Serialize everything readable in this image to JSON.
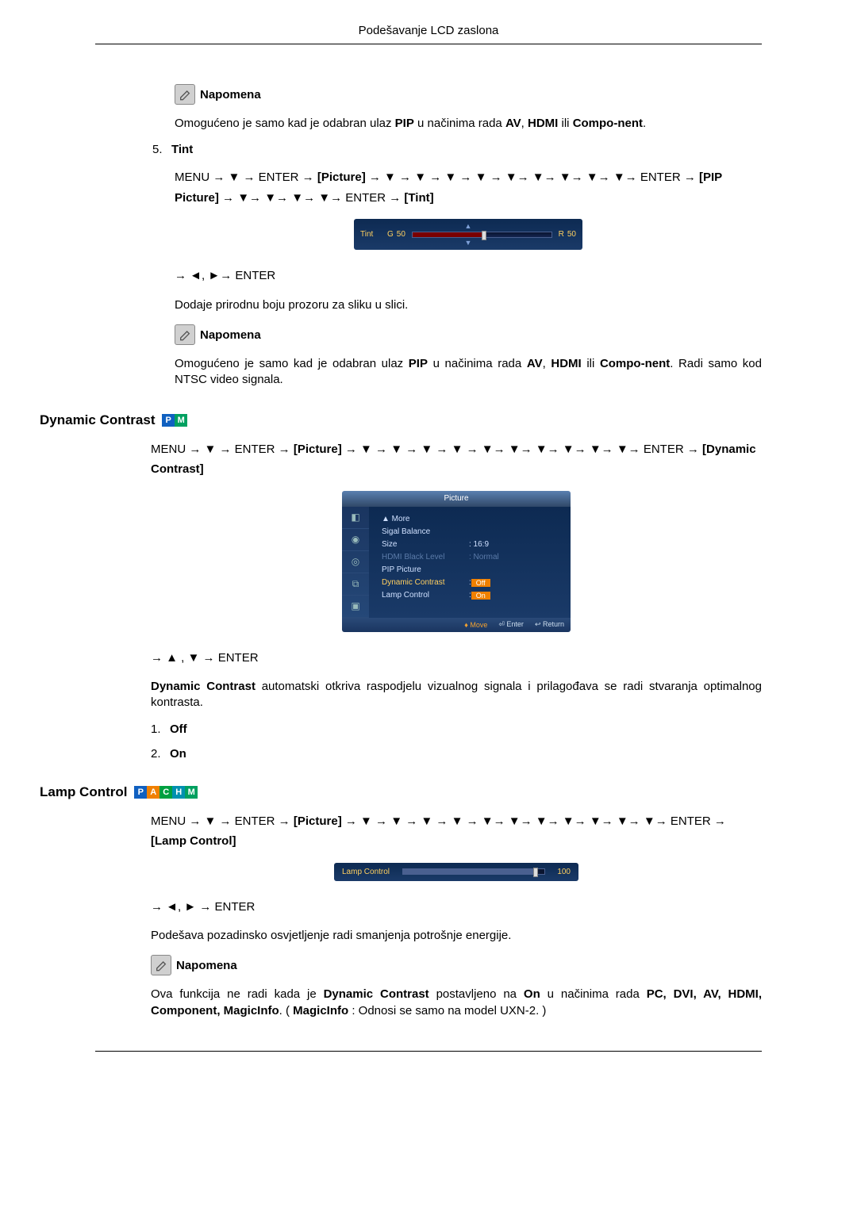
{
  "header": {
    "title": "Podešavanje LCD zaslona"
  },
  "notes": {
    "label": "Napomena"
  },
  "sec1": {
    "p1a": "Omogućeno je samo kad je odabran ulaz ",
    "p1_pip": "PIP",
    "p1b": " u načinima rada ",
    "p1_av": "AV",
    "p1c": ", ",
    "p1_hdmi": "HDMI",
    "p1d": " ili ",
    "p1_comp": "Compo-nent",
    "p1e": ".",
    "item5_num": "5.",
    "item5_label": "Tint",
    "nav1a": "MENU → ▼ → ENTER → ",
    "nav1_pic": "[Picture]",
    "nav1b": " → ▼ → ▼ → ▼ → ▼ → ▼→ ▼→ ▼→ ▼→ ▼→ ENTER → ",
    "nav1_pip": "[PIP Picture]",
    "nav1c": " → ▼→ ▼→ ▼→ ▼→ ENTER → ",
    "nav1_tint": "[Tint]",
    "nav2": "→ ◄, ►→ ENTER",
    "p2": "Dodaje prirodnu boju prozoru za sliku u slici.",
    "p3a": "Omogućeno je samo kad je odabran ulaz ",
    "p3_pip": "PIP",
    "p3b": " u načinima rada ",
    "p3_av": "AV",
    "p3c": ", ",
    "p3_hdmi": "HDMI",
    "p3d": " ili ",
    "p3_comp": "Compo-nent",
    "p3e": ". Radi samo kod NTSC video signala."
  },
  "tint_osd": {
    "label": "Tint",
    "g_label": "G",
    "g_val": "50",
    "r_label": "R",
    "r_val": "50"
  },
  "dyn": {
    "heading": "Dynamic Contrast",
    "nav1a": "MENU → ▼ → ENTER → ",
    "nav1_pic": "[Picture]",
    "nav1b": " → ▼ → ▼ → ▼ → ▼ → ▼→ ▼→ ▼→ ▼→ ▼→ ▼→ ENTER → ",
    "nav1_dc": "[Dynamic Contrast]",
    "nav2": "→ ▲ , ▼ → ENTER",
    "p1a": "Dynamic Contrast",
    "p1b": " automatski otkriva raspodjelu vizualnog signala i prilagođava se radi stvaranja optimalnog kontrasta.",
    "i1n": "1.",
    "i1": "Off",
    "i2n": "2.",
    "i2": "On"
  },
  "picture_osd": {
    "title": "Picture",
    "items": [
      {
        "k": "▲ More",
        "v": ""
      },
      {
        "k": "Sigal Balance",
        "v": ""
      },
      {
        "k": "Size",
        "v": ": 16:9"
      },
      {
        "k": "HDMI Black Level",
        "v": ": Normal",
        "dim": true
      },
      {
        "k": "PIP Picture",
        "v": ""
      },
      {
        "k": "Dynamic Contrast",
        "v": "Off",
        "hl": true
      },
      {
        "k": "Lamp Control",
        "v": "On",
        "valbox": true
      }
    ],
    "footer": {
      "move": "Move",
      "enter": "Enter",
      "return": "Return"
    }
  },
  "lamp": {
    "heading": "Lamp Control",
    "nav1a": "MENU → ▼ → ENTER → ",
    "nav1_pic": "[Picture]",
    "nav1b": " → ▼ → ▼ → ▼ → ▼ → ▼→ ▼→ ▼→ ▼→ ▼→ ▼→ ▼→ ENTER → ",
    "nav1_lc": "[Lamp Control]",
    "nav2": "→ ◄, ► → ENTER",
    "p1": "Podešava pozadinsko osvjetljenje radi smanjenja potrošnje energije.",
    "p2a": "Ova funkcija ne radi kada je ",
    "p2_dc": "Dynamic Contrast",
    "p2b": " postavljeno na ",
    "p2_on": "On",
    "p2c": " u načinima rada ",
    "p2_modes": "PC, DVI, AV, HDMI, Component, MagicInfo",
    "p2d": ". ( ",
    "p2_mi": "MagicInfo",
    "p2e": " : Odnosi se samo na model UXN-2. )"
  },
  "lamp_osd": {
    "label": "Lamp Control",
    "value": "100"
  },
  "badges": {
    "P": "P",
    "A": "A",
    "C": "C",
    "H": "H",
    "M": "M"
  }
}
